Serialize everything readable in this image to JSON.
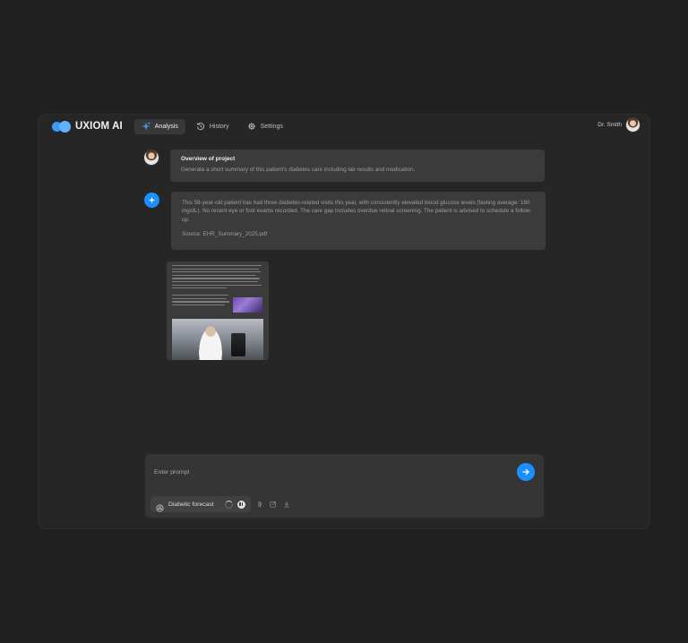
{
  "header": {
    "brand": "UXIOM AI",
    "tabs": [
      {
        "label": "Analysis",
        "icon": "sparkle-icon",
        "active": true
      },
      {
        "label": "History",
        "icon": "history-icon",
        "active": false
      },
      {
        "label": "Settings",
        "icon": "gear-icon",
        "active": false
      }
    ],
    "user_name": "Dr. Smith"
  },
  "conversation": {
    "question": {
      "title": "Overview of project",
      "text": "Generate a short summary of this patient's diabetes care including lab results and medication."
    },
    "answer": {
      "text": "This 58-year-old patient has had three diabetes-related visits this year, with consistently elevated blood glucose levels (fasting average: 160 mg/dL). No recent eye or foot exams recorded. The care gap includes overdue retinal screening. The patient is advised to schedule a follow-up.",
      "source": "Source:  EHR_Summary_2025.pdf"
    }
  },
  "composer": {
    "placeholder": "Enter prompt",
    "chip_label": "Diabetic forecast"
  },
  "colors": {
    "accent": "#1a8fff",
    "background": "#202020",
    "panel": "#262626",
    "bubble": "#3b3b3b"
  }
}
